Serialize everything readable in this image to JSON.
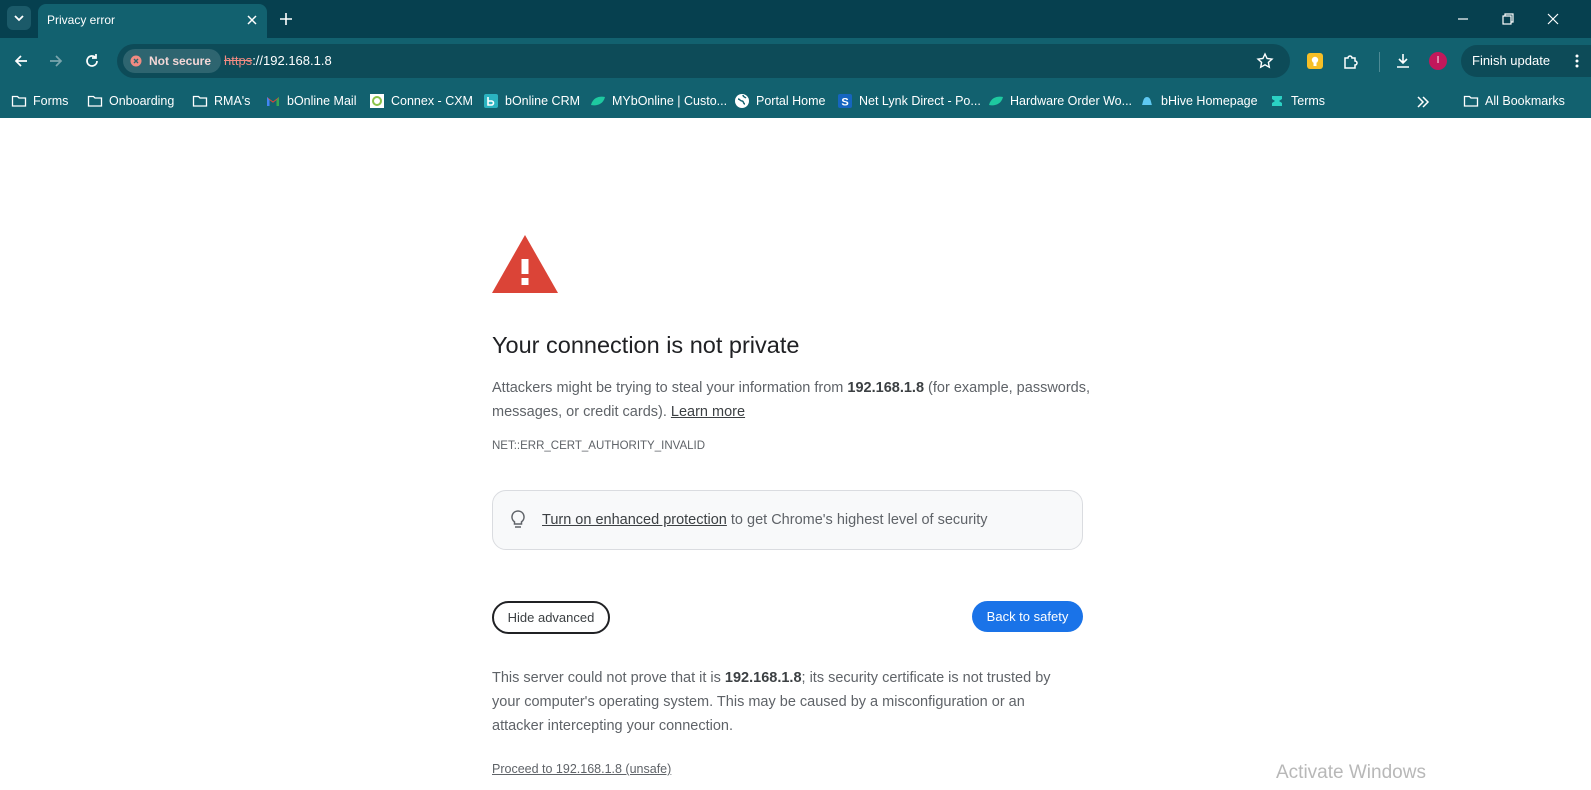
{
  "browser": {
    "tab_title": "Privacy error",
    "security_chip": "Not secure",
    "url_scheme": "https",
    "url_rest": "://192.168.1.8",
    "finish_update": "Finish update",
    "avatar_initial": "I"
  },
  "bookmarks": [
    {
      "label": "Forms",
      "icon": "folder-icon"
    },
    {
      "label": "Onboarding",
      "icon": "folder-icon"
    },
    {
      "label": "RMA's",
      "icon": "folder-icon"
    },
    {
      "label": "bOnline Mail",
      "icon": "gmail-icon"
    },
    {
      "label": "Connex - CXM",
      "icon": "connex-icon"
    },
    {
      "label": "bOnline CRM",
      "icon": "crm-icon"
    },
    {
      "label": "MYbOnline | Custo...",
      "icon": "leaf-icon"
    },
    {
      "label": "Portal Home",
      "icon": "globe-icon"
    },
    {
      "label": "Net Lynk Direct - Po...",
      "icon": "s-icon"
    },
    {
      "label": "Hardware Order Wo...",
      "icon": "leaf-icon"
    },
    {
      "label": "bHive Homepage",
      "icon": "bell-icon"
    },
    {
      "label": "Terms",
      "icon": "terms-icon"
    }
  ],
  "all_bookmarks": "All Bookmarks",
  "page": {
    "heading": "Your connection is not private",
    "intro_before": "Attackers might be trying to steal your information from ",
    "host": "192.168.1.8",
    "intro_after": " (for example, passwords, messages, or credit cards). ",
    "learn_more": "Learn more",
    "error_code": "NET::ERR_CERT_AUTHORITY_INVALID",
    "enhanced_link": "Turn on enhanced protection",
    "enhanced_rest": " to get Chrome's highest level of security",
    "hide_advanced": "Hide advanced",
    "back_to_safety": "Back to safety",
    "detail_before": "This server could not prove that it is ",
    "detail_host": "192.168.1.8",
    "detail_after": "; its security certificate is not trusted by your computer's operating system. This may be caused by a misconfiguration or an attacker intercepting your connection.",
    "proceed": "Proceed to 192.168.1.8 (unsafe)"
  },
  "watermark": "Activate Windows",
  "colors": {
    "tabstrip": "#06404f",
    "toolbar": "#12616f",
    "primary_button": "#1a73e8",
    "warning_red": "#db4437"
  }
}
